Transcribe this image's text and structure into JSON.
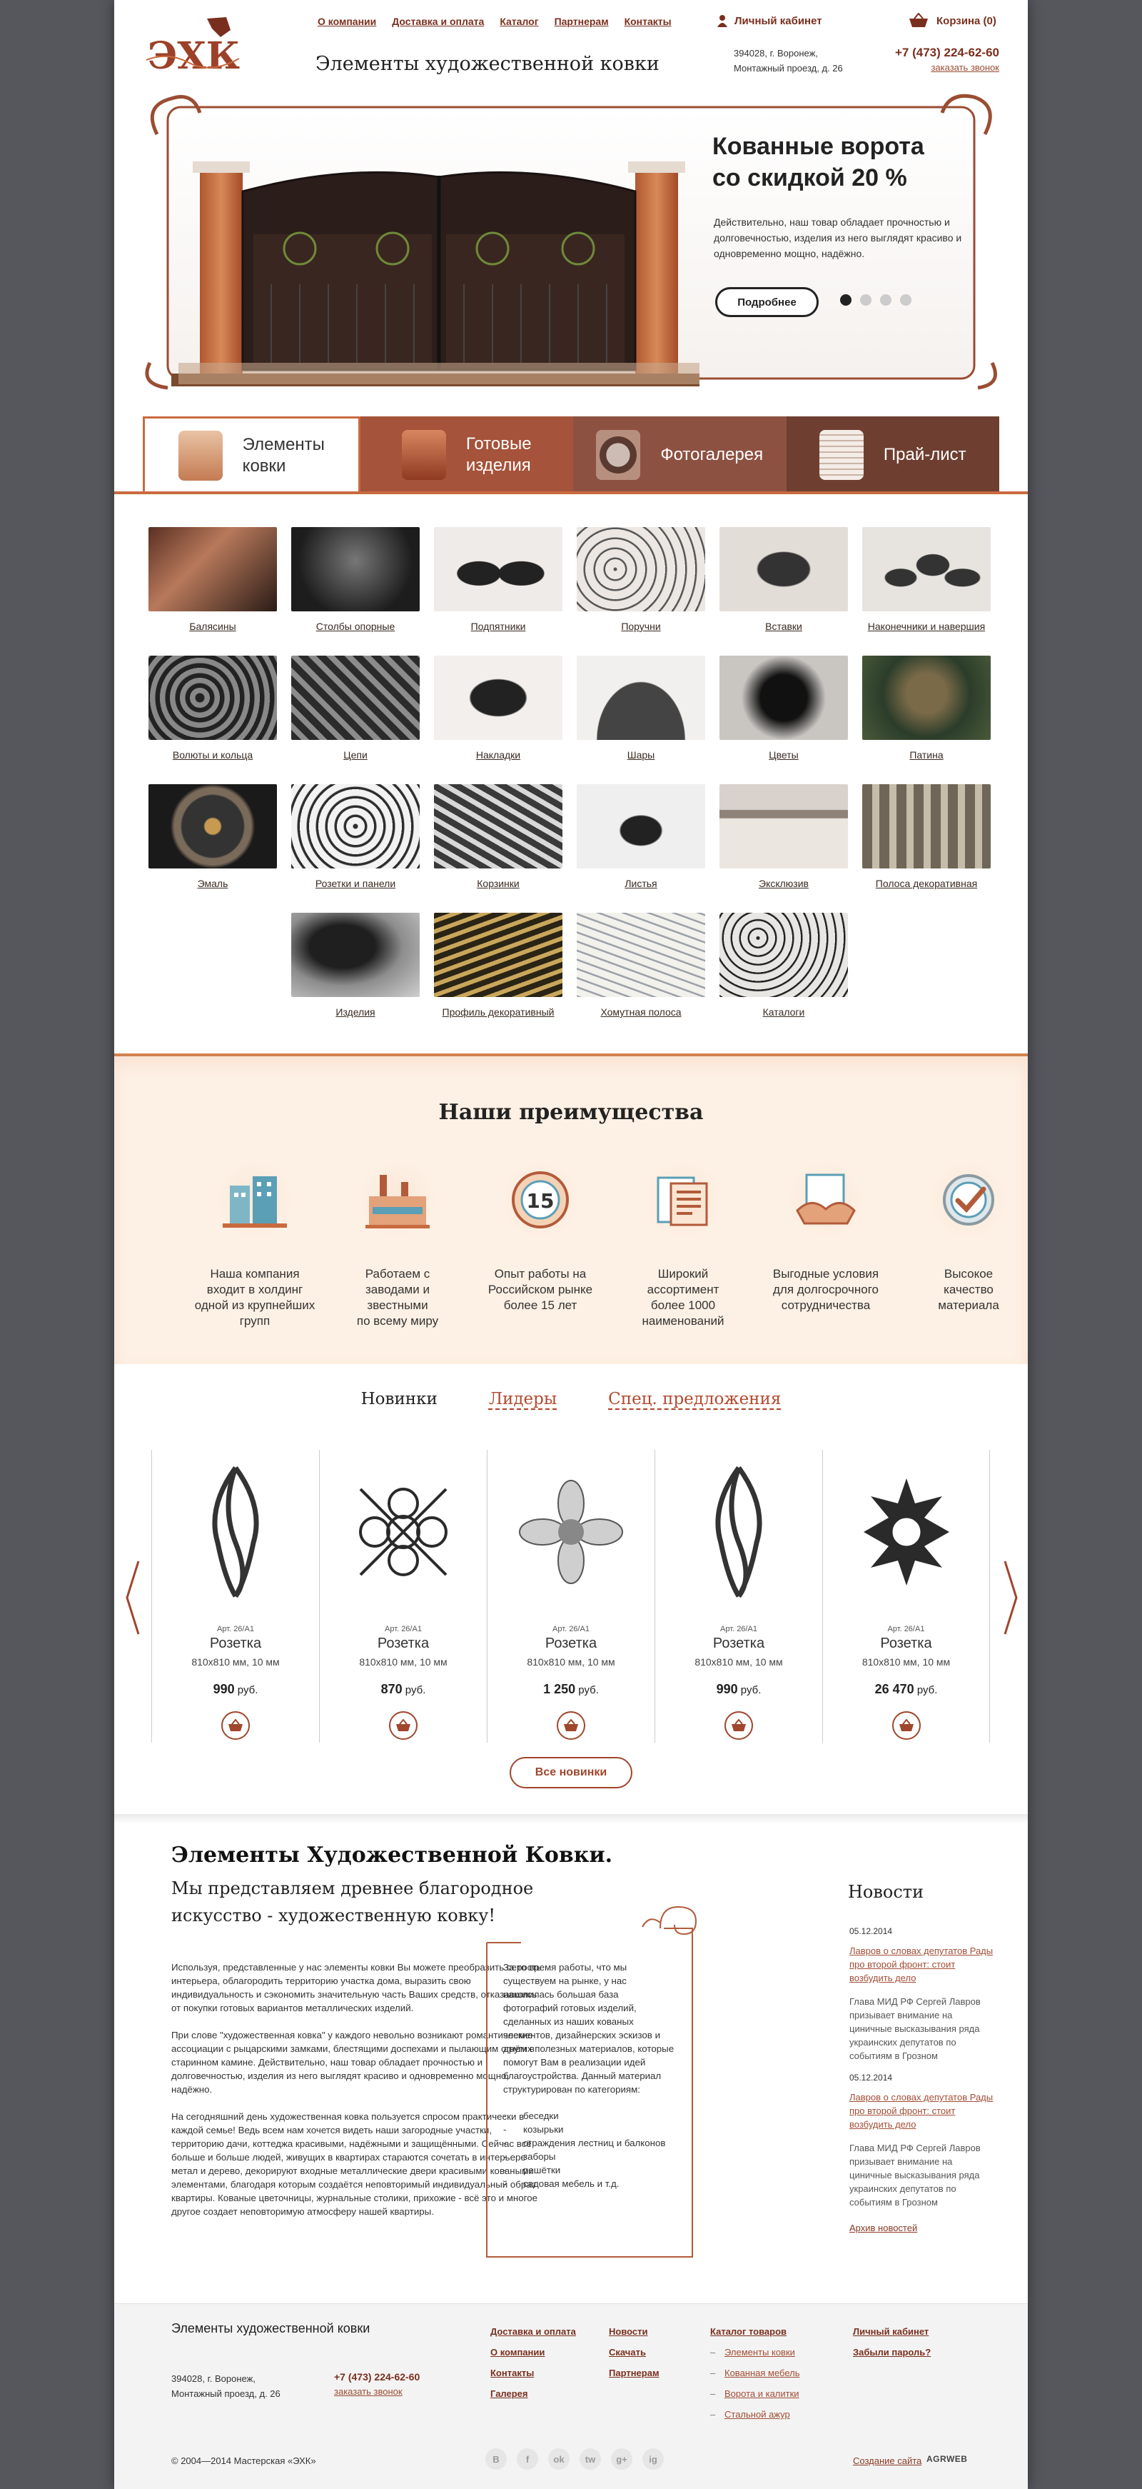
{
  "header": {
    "logo_text": "ЭХК",
    "site_title": "Элементы художественной ковки",
    "nav": [
      "О компании",
      "Доставка и оплата",
      "Каталог",
      "Партнерам",
      "Контакты"
    ],
    "account": "Личный кабинет",
    "cart": "Корзина (0)",
    "address_line1": "394028, г. Воронеж,",
    "address_line2": "Монтажный проезд, д. 26",
    "phone": "+7 (473) 224-62-60",
    "callback": "заказать звонок"
  },
  "slider": {
    "title_line1": "Кованные ворота",
    "title_line2": "со скидкой 20 %",
    "text": "Действительно, наш товар обладает прочностью и долговечностью, изделия из него выглядят красиво и одновременно мощно, надёжно.",
    "button": "Подробнее",
    "slides_total": 4,
    "active_slide": 1
  },
  "tabs": [
    {
      "label_line1": "Элементы",
      "label_line2": "ковки",
      "active": true
    },
    {
      "label_line1": "Готовые",
      "label_line2": "изделия",
      "active": false
    },
    {
      "label_line1": "Фотогалерея",
      "label_line2": "",
      "active": false
    },
    {
      "label_line1": "Прай-лист",
      "label_line2": "",
      "active": false
    }
  ],
  "catalog": [
    "Балясины",
    "Столбы опорные",
    "Подпятники",
    "Поручни",
    "Вставки",
    "Наконечники и навершия",
    "Волюты и кольца",
    "Цепи",
    "Накладки",
    "Шары",
    "Цветы",
    "Патина",
    "Эмаль",
    "Розетки и панели",
    "Корзинки",
    "Листья",
    "Эксклюзив",
    "Полоса декоративная",
    "Изделия",
    "Профиль декоративный",
    "Хомутная полоса",
    "Каталоги"
  ],
  "advantages": {
    "title": "Наши преимущества",
    "items": [
      [
        "Наша компания",
        "входит в холдинг",
        "одной из крупнейших",
        "групп"
      ],
      [
        "Работаем с",
        "заводами и",
        "звестными",
        "по всему миру"
      ],
      [
        "Опыт работы на",
        "Российском рынке",
        "более 15 лет"
      ],
      [
        "Широкий",
        "ассортимент",
        "более 1000",
        "наименований"
      ],
      [
        "Выгодные условия",
        "для долгосрочного",
        "сотрудничества"
      ],
      [
        "Высокое",
        "качество",
        "материала"
      ]
    ],
    "badge_number": "15"
  },
  "products": {
    "tabs": [
      "Новинки",
      "Лидеры",
      "Спец. предложения"
    ],
    "currency": "руб.",
    "items": [
      {
        "art": "Арт. 26/А1",
        "name": "Розетка",
        "size": "810x810 мм, 10 мм",
        "price": "990"
      },
      {
        "art": "Арт. 26/А1",
        "name": "Розетка",
        "size": "810x810 мм, 10 мм",
        "price": "870"
      },
      {
        "art": "Арт. 26/А1",
        "name": "Розетка",
        "size": "810x810 мм, 10 мм",
        "price": "1 250"
      },
      {
        "art": "Арт. 26/А1",
        "name": "Розетка",
        "size": "810x810 мм, 10 мм",
        "price": "990"
      },
      {
        "art": "Арт. 26/А1",
        "name": "Розетка",
        "size": "810x810 мм, 10 мм",
        "price": "26 470"
      }
    ],
    "all_button": "Все новинки"
  },
  "about": {
    "heading": "Элементы Художественной Ковки.",
    "subheading": "Мы представляем древнее благородное искусство - художественную ковку!",
    "paragraphs": [
      "Используя, представленные у нас элементы ковки Вы можете преобразить серость интерьера, облагородить территорию участка дома, выразить свою индивидуальность и сэкономить значительную часть Ваших средств, отказавшись от покупки готовых вариантов металлических изделий.",
      "При слове \"художественная ковка\" у каждого невольно возникают романтические ассоциации с рыцарскими замками, блестящими доспехами и пылающим огнём в старинном камине. Действительно, наш товар обладает прочностью и долговечностью, изделия из него выглядят красиво и одновременно мощно, надёжно.",
      "На сегодняшний день художественная ковка пользуется спросом практически в каждой семье! Ведь всем нам хочется видеть наши загородные участки, территорию дачи, коттеджа красивыми, надёжными и защищёнными. Сейчас всё больше и больше людей, живущих в квартирах стараются сочетать в интерьере метал и дерево, декорируют входные металлические двери красивыми коваными элементами, благодаря которым создаётся неповторимый индивидуальный образ квартиры. Кованые цветочницы, журнальные столики, прихожие - всё это и многое другое создает неповторимую атмосферу нашей квартиры."
    ],
    "frame_text": "За то время работы, что мы существуем на рынке, у нас накопилась большая база фотографий готовых изделий, сделанных из наших кованых элементов, дизайнерских эскизов и других полезных материалов, которые помогут Вам в реализации идей благоустройства. Данный материал структурирован по категориям:",
    "frame_list": [
      "беседки",
      "козырьки",
      "ограждения лестниц и балконов",
      "заборы",
      "решётки",
      "садовая мебель и т.д."
    ]
  },
  "news": {
    "heading": "Новости",
    "items": [
      {
        "date": "05.12.2014",
        "title": "Лавров о словах депутатов Рады про второй фронт: стоит возбудить дело",
        "text": "Глава МИД РФ Сергей Лавров призывает внимание на циничные высказывания ряда украинских депутатов по событиям в Грозном"
      },
      {
        "date": "05.12.2014",
        "title": "Лавров о словах депутатов Рады про второй фронт: стоит возбудить дело",
        "text": "Глава МИД РФ Сергей Лавров призывает внимание на циничные высказывания ряда украинских депутатов по событиям в Грозном"
      }
    ],
    "archive": "Архив новостей"
  },
  "footer": {
    "title": "Элементы художественной ковки",
    "address_line1": "394028, г. Воронеж,",
    "address_line2": "Монтажный проезд, д. 26",
    "phone": "+7 (473) 224-62-60",
    "callback": "заказать звонок",
    "col1": [
      "Доставка и оплата",
      "О компании",
      "Контакты",
      "Галерея"
    ],
    "col2": [
      "Новости",
      "Скачать",
      "Партнерам"
    ],
    "col3_title": "Каталог товаров",
    "col3_items": [
      "Элементы ковки",
      "Кованная мебель",
      "Ворота и калитки",
      "Стальной ажур"
    ],
    "col4": [
      "Личный кабинет",
      "Забыли пароль?"
    ],
    "copyright": "© 2004—2014 Мастерская «ЭХК»",
    "social": [
      "В",
      "f",
      "ok",
      "tw",
      "g+",
      "ig"
    ],
    "made_by": "Создание сайта",
    "agency": "AGRWEB"
  },
  "colors": {
    "brand": "#7a2f1e",
    "accent": "#c96a3f",
    "tab2": "#a5533a",
    "tab3": "#8d5142",
    "tab4": "#6e3f31",
    "adv_bg": "#fdf0e4"
  }
}
